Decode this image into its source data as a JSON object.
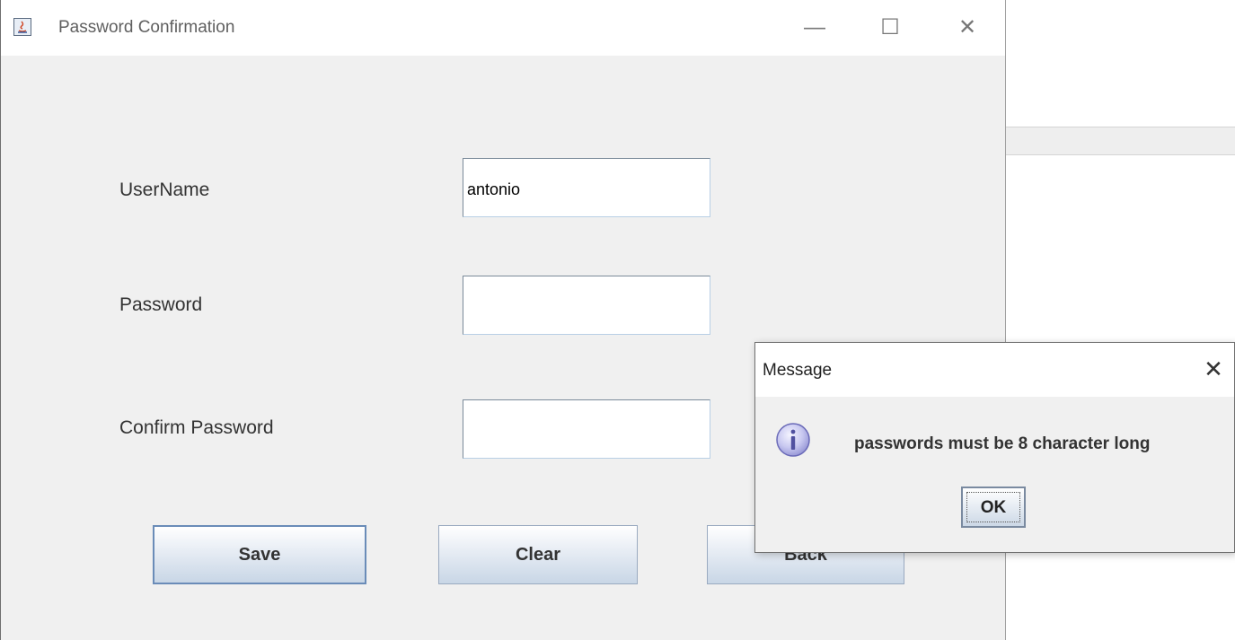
{
  "window": {
    "title": "Password Confirmation",
    "icon": "java-icon",
    "controls": {
      "minimize": "—",
      "maximize": "☐",
      "close": "✕"
    }
  },
  "form": {
    "username_label": "UserName",
    "username_value": "antonio",
    "password_label": "Password",
    "password_value": "",
    "confirm_label": "Confirm Password",
    "confirm_value": ""
  },
  "buttons": {
    "save": "Save",
    "clear": "Clear",
    "back": "Back"
  },
  "dialog": {
    "title": "Message",
    "close": "✕",
    "icon": "info-icon",
    "message": "passwords must be 8 character long",
    "ok": "OK"
  },
  "colors": {
    "window_bg": "#f0f0f0",
    "button_border": "#7a8aa0",
    "info_icon": "#8a8ad8"
  }
}
